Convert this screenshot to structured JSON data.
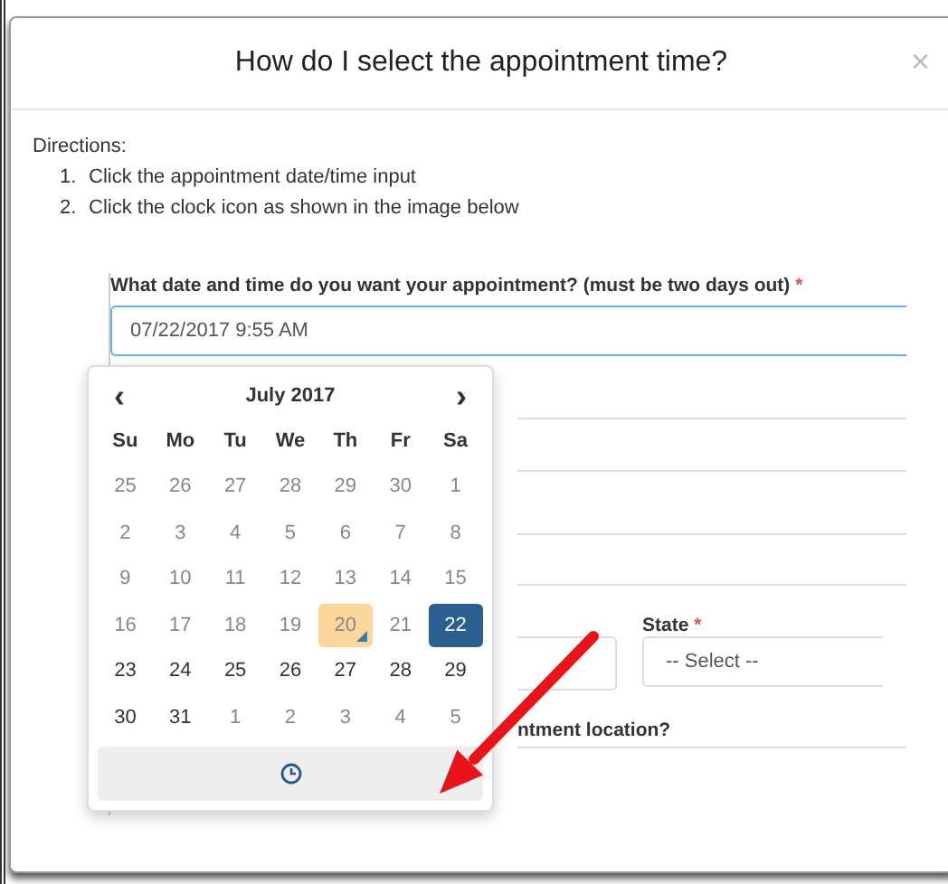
{
  "modal": {
    "title": "How do I select the appointment time?",
    "close": "×"
  },
  "directions": {
    "heading": "Directions:",
    "steps": [
      {
        "number": "1.",
        "text": "Click the appointment date/time input"
      },
      {
        "number": "2.",
        "text": "Click the clock icon as shown in the image below"
      }
    ]
  },
  "field": {
    "label": "What date and time do you want your appointment? (must be two days out)",
    "required": "*",
    "value": "07/22/2017 9:55 AM"
  },
  "calendar": {
    "prev": "‹",
    "next": "›",
    "month": "July 2017",
    "weekdays": [
      "Su",
      "Mo",
      "Tu",
      "We",
      "Th",
      "Fr",
      "Sa"
    ],
    "weeks": [
      [
        {
          "label": "25",
          "disabled": true,
          "today": false,
          "selected": false
        },
        {
          "label": "26",
          "disabled": true,
          "today": false,
          "selected": false
        },
        {
          "label": "27",
          "disabled": true,
          "today": false,
          "selected": false
        },
        {
          "label": "28",
          "disabled": true,
          "today": false,
          "selected": false
        },
        {
          "label": "29",
          "disabled": true,
          "today": false,
          "selected": false
        },
        {
          "label": "30",
          "disabled": true,
          "today": false,
          "selected": false
        },
        {
          "label": "1",
          "disabled": true,
          "today": false,
          "selected": false
        }
      ],
      [
        {
          "label": "2",
          "disabled": true,
          "today": false,
          "selected": false
        },
        {
          "label": "3",
          "disabled": true,
          "today": false,
          "selected": false
        },
        {
          "label": "4",
          "disabled": true,
          "today": false,
          "selected": false
        },
        {
          "label": "5",
          "disabled": true,
          "today": false,
          "selected": false
        },
        {
          "label": "6",
          "disabled": true,
          "today": false,
          "selected": false
        },
        {
          "label": "7",
          "disabled": true,
          "today": false,
          "selected": false
        },
        {
          "label": "8",
          "disabled": true,
          "today": false,
          "selected": false
        }
      ],
      [
        {
          "label": "9",
          "disabled": true,
          "today": false,
          "selected": false
        },
        {
          "label": "10",
          "disabled": true,
          "today": false,
          "selected": false
        },
        {
          "label": "11",
          "disabled": true,
          "today": false,
          "selected": false
        },
        {
          "label": "12",
          "disabled": true,
          "today": false,
          "selected": false
        },
        {
          "label": "13",
          "disabled": true,
          "today": false,
          "selected": false
        },
        {
          "label": "14",
          "disabled": true,
          "today": false,
          "selected": false
        },
        {
          "label": "15",
          "disabled": true,
          "today": false,
          "selected": false
        }
      ],
      [
        {
          "label": "16",
          "disabled": true,
          "today": false,
          "selected": false
        },
        {
          "label": "17",
          "disabled": true,
          "today": false,
          "selected": false
        },
        {
          "label": "18",
          "disabled": true,
          "today": false,
          "selected": false
        },
        {
          "label": "19",
          "disabled": true,
          "today": false,
          "selected": false
        },
        {
          "label": "20",
          "disabled": true,
          "today": true,
          "selected": false
        },
        {
          "label": "21",
          "disabled": true,
          "today": false,
          "selected": false
        },
        {
          "label": "22",
          "disabled": false,
          "today": false,
          "selected": true
        }
      ],
      [
        {
          "label": "23",
          "disabled": false,
          "today": false,
          "selected": false
        },
        {
          "label": "24",
          "disabled": false,
          "today": false,
          "selected": false
        },
        {
          "label": "25",
          "disabled": false,
          "today": false,
          "selected": false
        },
        {
          "label": "26",
          "disabled": false,
          "today": false,
          "selected": false
        },
        {
          "label": "27",
          "disabled": false,
          "today": false,
          "selected": false
        },
        {
          "label": "28",
          "disabled": false,
          "today": false,
          "selected": false
        },
        {
          "label": "29",
          "disabled": false,
          "today": false,
          "selected": false
        }
      ],
      [
        {
          "label": "30",
          "disabled": false,
          "today": false,
          "selected": false
        },
        {
          "label": "31",
          "disabled": false,
          "today": false,
          "selected": false
        },
        {
          "label": "1",
          "disabled": true,
          "today": false,
          "selected": false
        },
        {
          "label": "2",
          "disabled": true,
          "today": false,
          "selected": false
        },
        {
          "label": "3",
          "disabled": true,
          "today": false,
          "selected": false
        },
        {
          "label": "4",
          "disabled": true,
          "today": false,
          "selected": false
        },
        {
          "label": "5",
          "disabled": true,
          "today": false,
          "selected": false
        }
      ]
    ]
  },
  "state_field": {
    "label": "State",
    "required": "*",
    "placeholder": "-- Select --"
  },
  "location_label": "ntment location?"
}
